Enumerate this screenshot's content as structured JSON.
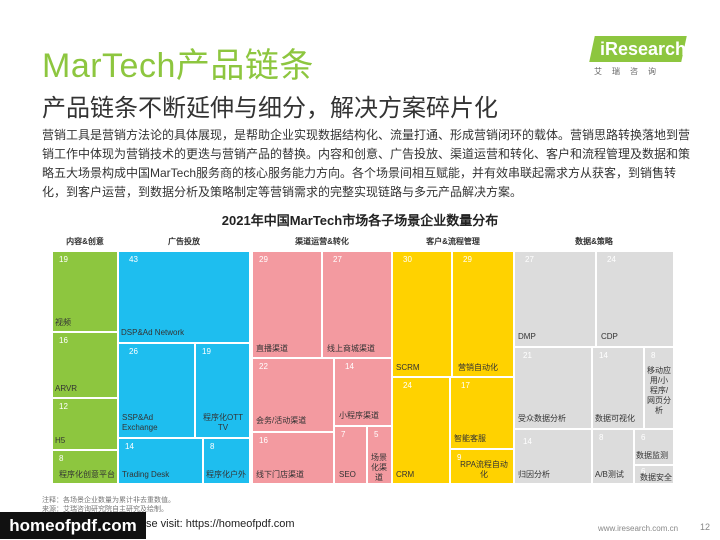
{
  "header": {
    "title": "MarTech产品链条",
    "subtitle": "产品链条不断延伸与细分，解决方案碎片化",
    "body": "营销工具是营销方法论的具体展现，是帮助企业实现数据结构化、流量打通、形成营销闭环的载体。营销思路转换落地到营销工作中体现为营销技术的更迭与营销产品的替换。内容和创意、广告投放、渠道运营和转化、客户和流程管理及数据和策略五大场景构成中国MarTech服务商的核心服务能力方向。各个场景间相互赋能，并有效串联起需求方从获客，到销售转化，到客户运营，到数据分析及策略制定等营销需求的完整实现链路与多元产品解决方案。"
  },
  "logo": {
    "text": "iResearch",
    "sub": "艾瑞咨询"
  },
  "chart_data": {
    "type": "treemap",
    "title": "2021年中国MarTech市场各子场景企业数量分布",
    "categories": [
      {
        "name": "内容&创意",
        "color": "#8dc63f",
        "items": [
          {
            "label": "视频",
            "value": 19
          },
          {
            "label": "ARVR",
            "value": 16
          },
          {
            "label": "H5",
            "value": 12
          },
          {
            "label": "程序化创意平台",
            "value": 8
          }
        ]
      },
      {
        "name": "广告投放",
        "color": "#1ebeef",
        "items": [
          {
            "label": "DSP&Ad Network",
            "value": 43
          },
          {
            "label": "SSP&Ad Exchange",
            "value": 26
          },
          {
            "label": "程序化OTT TV",
            "value": 19
          },
          {
            "label": "Trading Desk",
            "value": 14
          },
          {
            "label": "程序化户外",
            "value": 8
          }
        ]
      },
      {
        "name": "渠道运营&转化",
        "color": "#f39aa0",
        "items": [
          {
            "label": "直播渠道",
            "value": 29
          },
          {
            "label": "线上商城渠道",
            "value": 27
          },
          {
            "label": "会务/活动渠道",
            "value": 22
          },
          {
            "label": "小程序渠道",
            "value": 14
          },
          {
            "label": "线下门店渠道",
            "value": 16
          },
          {
            "label": "SEO",
            "value": 7
          },
          {
            "label": "场景化渠道",
            "value": 5
          }
        ]
      },
      {
        "name": "客户&流程管理",
        "color": "#ffd200",
        "items": [
          {
            "label": "SCRM",
            "value": 30
          },
          {
            "label": "营销自动化",
            "value": 29
          },
          {
            "label": "CRM",
            "value": 24
          },
          {
            "label": "智能客服",
            "value": 17
          },
          {
            "label": "RPA流程自动化",
            "value": 9
          }
        ]
      },
      {
        "name": "数据&策略",
        "color": "#dcdcdc",
        "items": [
          {
            "label": "DMP",
            "value": 27
          },
          {
            "label": "CDP",
            "value": 24
          },
          {
            "label": "受众数据分析",
            "value": 21
          },
          {
            "label": "数据可视化",
            "value": 14
          },
          {
            "label": "移动应用/小程序/网页分析",
            "value": 8
          },
          {
            "label": "归因分析",
            "value": 14
          },
          {
            "label": "A/B测试",
            "value": 8
          },
          {
            "label": "数据监测",
            "value": 6
          },
          {
            "label": "数据安全",
            "value": 6
          }
        ]
      }
    ]
  },
  "footer": {
    "note_line1": "注释：各场景企业数量为累计非去重数值。",
    "note_line2": "来源：艾瑞咨询研究院自主研究及绘制。",
    "banner": "homeofpdf.com",
    "banner_link": "se visit: https://homeofpdf.com",
    "url": "www.iresearch.com.cn",
    "page": "12"
  }
}
